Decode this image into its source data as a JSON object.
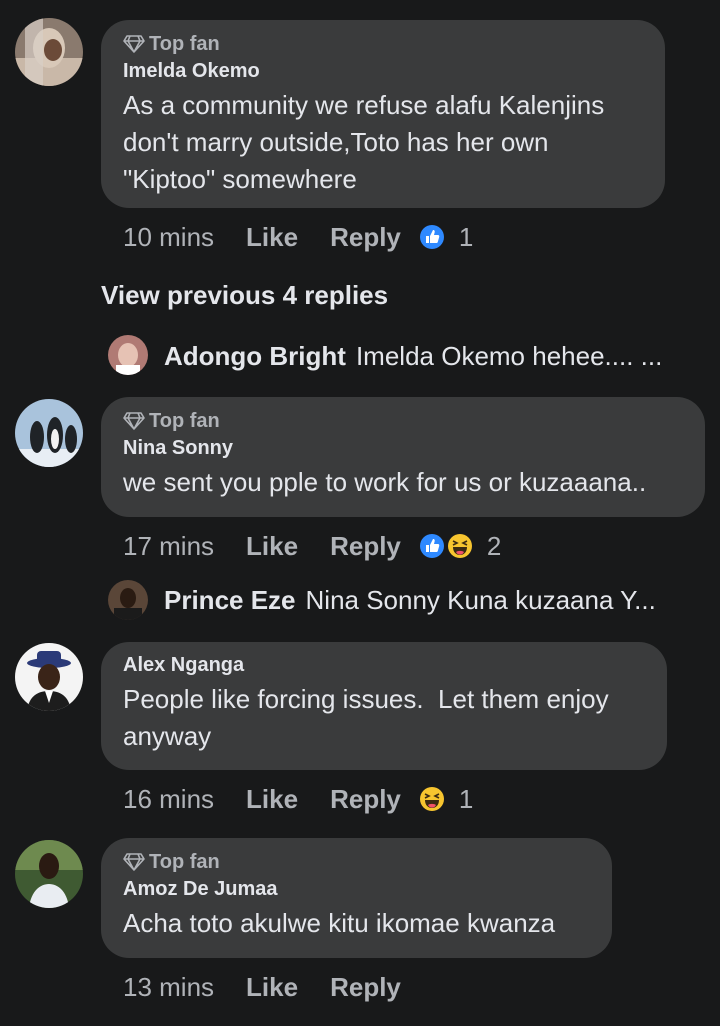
{
  "comments": [
    {
      "badge": "Top fan",
      "author": "Imelda Okemo",
      "text": "As a community we refuse alafu Kalenjins don't marry outside,Toto has her own \"Kiptoo\" somewhere",
      "time": "10 mins",
      "like_label": "Like",
      "reply_label": "Reply",
      "reactions": [
        "like"
      ],
      "reaction_count": "1"
    },
    {
      "badge": "Top fan",
      "author": "Nina Sonny",
      "text": "we sent you pple to work for us or kuzaaana..",
      "time": "17 mins",
      "like_label": "Like",
      "reply_label": "Reply",
      "reactions": [
        "like",
        "haha"
      ],
      "reaction_count": "2"
    },
    {
      "badge": "",
      "author": "Alex Nganga",
      "text": "People like forcing issues.  Let them enjoy anyway",
      "time": "16 mins",
      "like_label": "Like",
      "reply_label": "Reply",
      "reactions": [
        "haha"
      ],
      "reaction_count": "1"
    },
    {
      "badge": "Top fan",
      "author": "Amoz De Jumaa",
      "text": "Acha toto akulwe kitu ikomae kwanza",
      "time": "13 mins",
      "like_label": "Like",
      "reply_label": "Reply",
      "reactions": [],
      "reaction_count": ""
    }
  ],
  "view_previous": "View previous 4 replies",
  "replies": [
    {
      "author": "Adongo Bright",
      "text": "Imelda Okemo hehee.... ..."
    },
    {
      "author": "Prince Eze",
      "text": "Nina Sonny Kuna kuzaana Y..."
    }
  ],
  "colors": {
    "background": "#18191a",
    "bubble": "#3a3b3c",
    "text": "#e4e6eb",
    "secondary": "#b0b3b8",
    "like_blue": "#2e89ff",
    "haha_yellow": "#f7c52f"
  },
  "icons": {
    "badge": "diamond-icon",
    "like": "like-reaction-icon",
    "haha": "haha-reaction-icon"
  }
}
